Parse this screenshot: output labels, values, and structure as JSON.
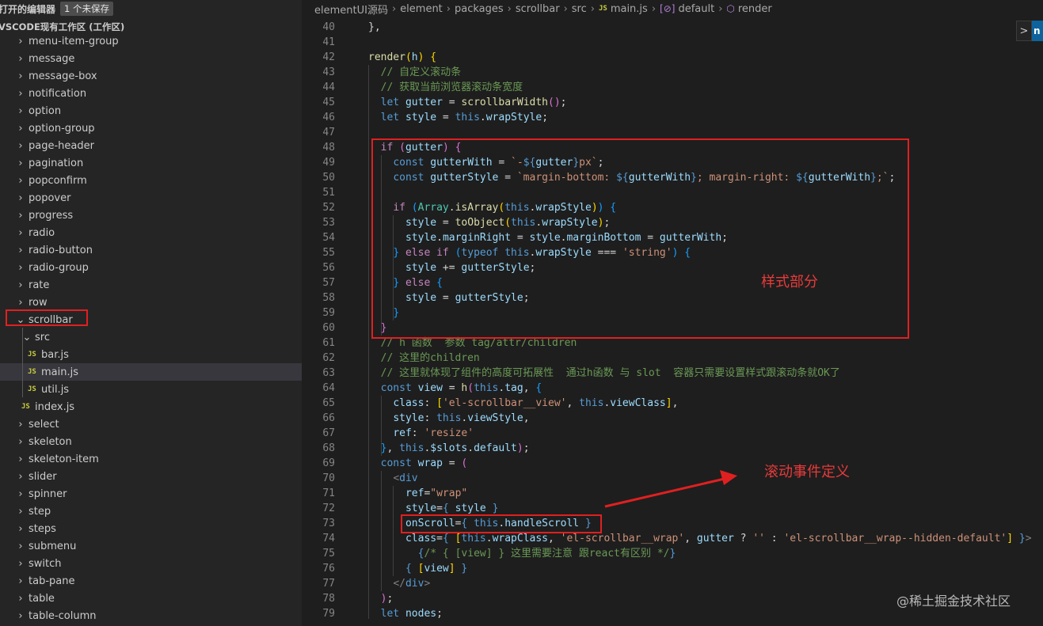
{
  "sidebar": {
    "open_editors_title": "打开的编辑器",
    "unsaved_badge": "1 个未保存",
    "workspace_title": "VSCODE现有工作区 (工作区)",
    "items": [
      {
        "label": "menu-item-group",
        "type": "folder"
      },
      {
        "label": "message",
        "type": "folder"
      },
      {
        "label": "message-box",
        "type": "folder"
      },
      {
        "label": "notification",
        "type": "folder"
      },
      {
        "label": "option",
        "type": "folder"
      },
      {
        "label": "option-group",
        "type": "folder"
      },
      {
        "label": "page-header",
        "type": "folder"
      },
      {
        "label": "pagination",
        "type": "folder"
      },
      {
        "label": "popconfirm",
        "type": "folder"
      },
      {
        "label": "popover",
        "type": "folder"
      },
      {
        "label": "progress",
        "type": "folder"
      },
      {
        "label": "radio",
        "type": "folder"
      },
      {
        "label": "radio-button",
        "type": "folder"
      },
      {
        "label": "radio-group",
        "type": "folder"
      },
      {
        "label": "rate",
        "type": "folder"
      },
      {
        "label": "row",
        "type": "folder"
      },
      {
        "label": "scrollbar",
        "type": "folder-open"
      },
      {
        "label": "src",
        "type": "folder-open"
      },
      {
        "label": "bar.js",
        "type": "js"
      },
      {
        "label": "main.js",
        "type": "js"
      },
      {
        "label": "util.js",
        "type": "js"
      },
      {
        "label": "index.js",
        "type": "js"
      },
      {
        "label": "select",
        "type": "folder"
      },
      {
        "label": "skeleton",
        "type": "folder"
      },
      {
        "label": "skeleton-item",
        "type": "folder"
      },
      {
        "label": "slider",
        "type": "folder"
      },
      {
        "label": "spinner",
        "type": "folder"
      },
      {
        "label": "step",
        "type": "folder"
      },
      {
        "label": "steps",
        "type": "folder"
      },
      {
        "label": "submenu",
        "type": "folder"
      },
      {
        "label": "switch",
        "type": "folder"
      },
      {
        "label": "tab-pane",
        "type": "folder"
      },
      {
        "label": "table",
        "type": "folder"
      },
      {
        "label": "table-column",
        "type": "folder"
      }
    ],
    "selected_item": "main.js",
    "js_icon_text": "JS"
  },
  "breadcrumb": {
    "parts": [
      "elementUI源码",
      "element",
      "packages",
      "scrollbar",
      "src"
    ],
    "file_icon": "JS",
    "file": "main.js",
    "symbol1": "default",
    "symbol2": "render"
  },
  "code": {
    "line_numbers": [
      "40",
      "41",
      "42",
      "43",
      "44",
      "45",
      "46",
      "47",
      "48",
      "49",
      "50",
      "51",
      "52",
      "53",
      "54",
      "55",
      "56",
      "57",
      "58",
      "59",
      "60",
      "61",
      "62",
      "63",
      "64",
      "65",
      "66",
      "67",
      "68",
      "69",
      "70",
      "71",
      "72",
      "73",
      "74",
      "75",
      "76",
      "77",
      "78",
      "79"
    ]
  },
  "annotations": {
    "style_part": "样式部分",
    "scroll_event": "滚动事件定义"
  },
  "minimap_toggle": ">",
  "watermark": "@稀土掘金技术社区",
  "colors": {
    "annotation_red": "#e02020",
    "editor_bg": "#1e1e1e",
    "sidebar_bg": "#252526"
  }
}
